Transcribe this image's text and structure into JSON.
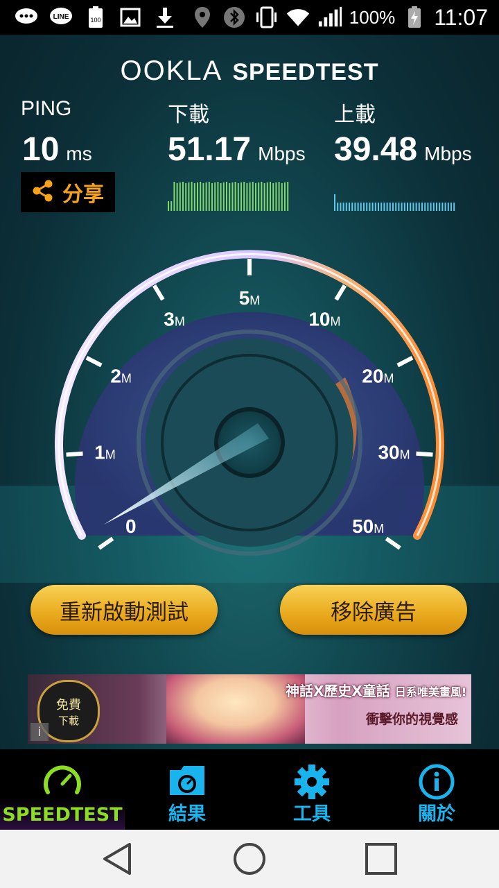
{
  "status_bar": {
    "battery_pct": "100%",
    "time": "11:07",
    "icons": [
      "chat-bubble-icon",
      "line-icon",
      "battery-100-icon",
      "image-icon",
      "download-icon",
      "location-icon",
      "bluetooth-icon",
      "vibrate-icon",
      "wifi-icon",
      "signal-icon",
      "charging-battery-icon"
    ]
  },
  "header": {
    "brand_left": "OOKLA",
    "brand_right": "SPEEDTEST"
  },
  "ping": {
    "label": "PING",
    "value": "10",
    "unit": "ms"
  },
  "download": {
    "label": "下載",
    "value": "51.17",
    "unit": "Mbps"
  },
  "upload": {
    "label": "上載",
    "value": "39.48",
    "unit": "Mbps"
  },
  "share": {
    "label": "分享"
  },
  "gauge": {
    "ticks": [
      {
        "num": "0",
        "unit": ""
      },
      {
        "num": "1",
        "unit": "M"
      },
      {
        "num": "2",
        "unit": "M"
      },
      {
        "num": "3",
        "unit": "M"
      },
      {
        "num": "5",
        "unit": "M"
      },
      {
        "num": "10",
        "unit": "M"
      },
      {
        "num": "20",
        "unit": "M"
      },
      {
        "num": "30",
        "unit": "M"
      },
      {
        "num": "50",
        "unit": "M"
      }
    ]
  },
  "buttons": {
    "restart": "重新啟動測試",
    "remove_ads": "移除廣告"
  },
  "ad": {
    "badge_top": "免費",
    "badge_bottom": "下載",
    "headline": "神話X歷史X童話",
    "headline2": "日系唯美畫風!",
    "tagline": "衝擊你的視覺感"
  },
  "nav": {
    "items": [
      {
        "label": "SPEEDTEST",
        "color": "#8cdc21"
      },
      {
        "label": "結果",
        "color": "#19b4ee"
      },
      {
        "label": "工具",
        "color": "#19b4ee"
      },
      {
        "label": "關於",
        "color": "#19b4ee"
      }
    ]
  },
  "colors": {
    "accent_orange": "#f7a21b",
    "nav_blue": "#19b4ee",
    "nav_green": "#8cdc21"
  }
}
